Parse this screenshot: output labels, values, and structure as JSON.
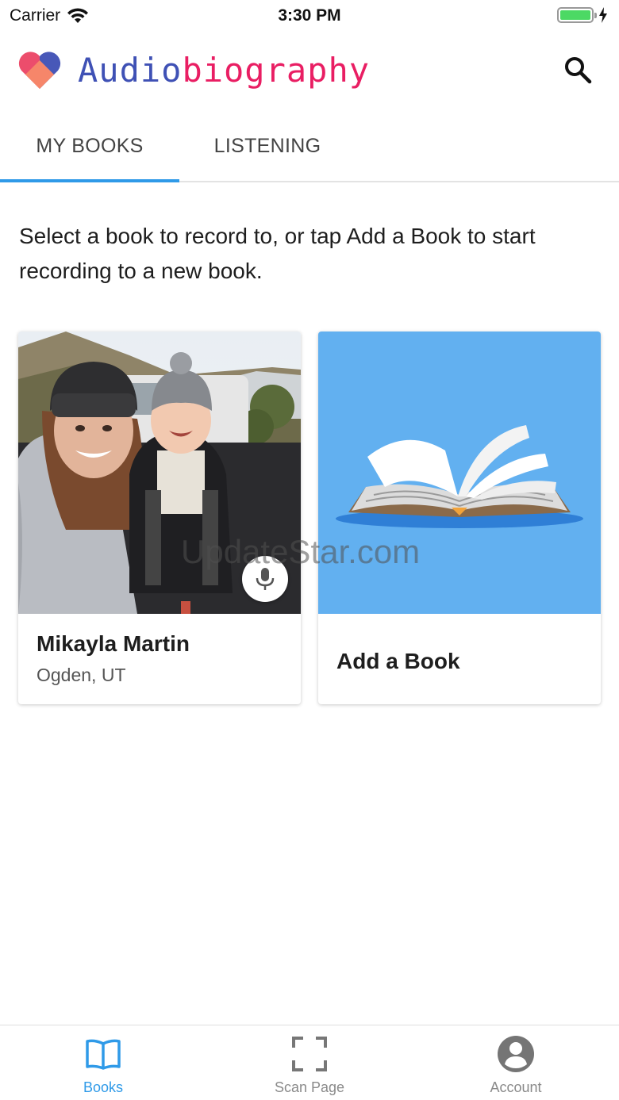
{
  "status_bar": {
    "carrier": "Carrier",
    "time": "3:30 PM",
    "battery_level": 1.0
  },
  "header": {
    "title_part1": "Audio",
    "title_part2": "biography",
    "logo_icon": "heart-logo-icon",
    "search_icon": "search-icon"
  },
  "tabs": [
    {
      "label": "MY BOOKS",
      "active": true
    },
    {
      "label": "LISTENING",
      "active": false
    }
  ],
  "intro_text": "Select a book to record to, or tap Add a Book to start recording to a new book.",
  "books": [
    {
      "title": "Mikayla Martin",
      "subtitle": "Ogden, UT",
      "action_icon": "microphone-icon"
    }
  ],
  "add_book": {
    "label": "Add a Book",
    "icon": "open-book-icon"
  },
  "watermark": "UpdateStar.com",
  "bottom_nav": [
    {
      "label": "Books",
      "icon": "book-icon",
      "active": true
    },
    {
      "label": "Scan Page",
      "icon": "scan-frame-icon",
      "active": false
    },
    {
      "label": "Account",
      "icon": "account-circle-icon",
      "active": false
    }
  ],
  "colors": {
    "accent": "#2f9ae8",
    "title_blue": "#3f51b5",
    "title_pink": "#e91e63",
    "add_book_bg": "#62b0f0",
    "battery": "#4cd964"
  }
}
